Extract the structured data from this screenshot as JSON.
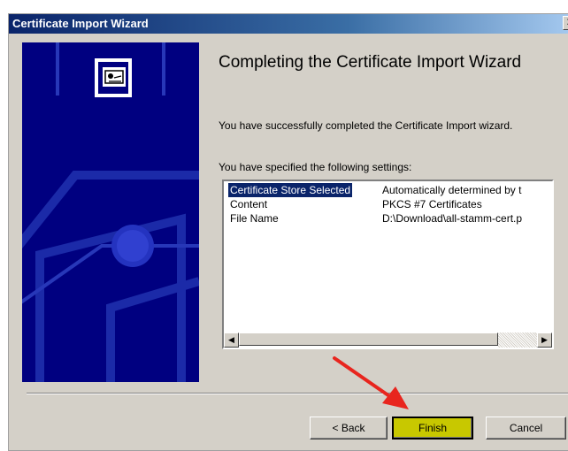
{
  "window": {
    "title": "Certificate Import Wizard",
    "close_glyph": "✕"
  },
  "page": {
    "heading": "Completing the Certificate Import Wizard",
    "description": "You have successfully completed the Certificate Import wizard.",
    "settings_label": "You have specified the following settings:"
  },
  "settings": [
    {
      "key": "Certificate Store Selected",
      "value": "Automatically determined by t"
    },
    {
      "key": "Content",
      "value": "PKCS #7 Certificates"
    },
    {
      "key": "File Name",
      "value": "D:\\Download\\all-stamm-cert.p"
    }
  ],
  "scrollbar": {
    "left_glyph": "◀",
    "right_glyph": "▶"
  },
  "buttons": {
    "back": "< Back",
    "finish": "Finish",
    "cancel": "Cancel"
  },
  "colors": {
    "banner": "#000080",
    "highlight": "#c8c800",
    "selection": "#0a246a",
    "arrow": "#e8251e"
  },
  "icons": {
    "banner": "certificate-icon",
    "annotation": "red-arrow-icon"
  }
}
